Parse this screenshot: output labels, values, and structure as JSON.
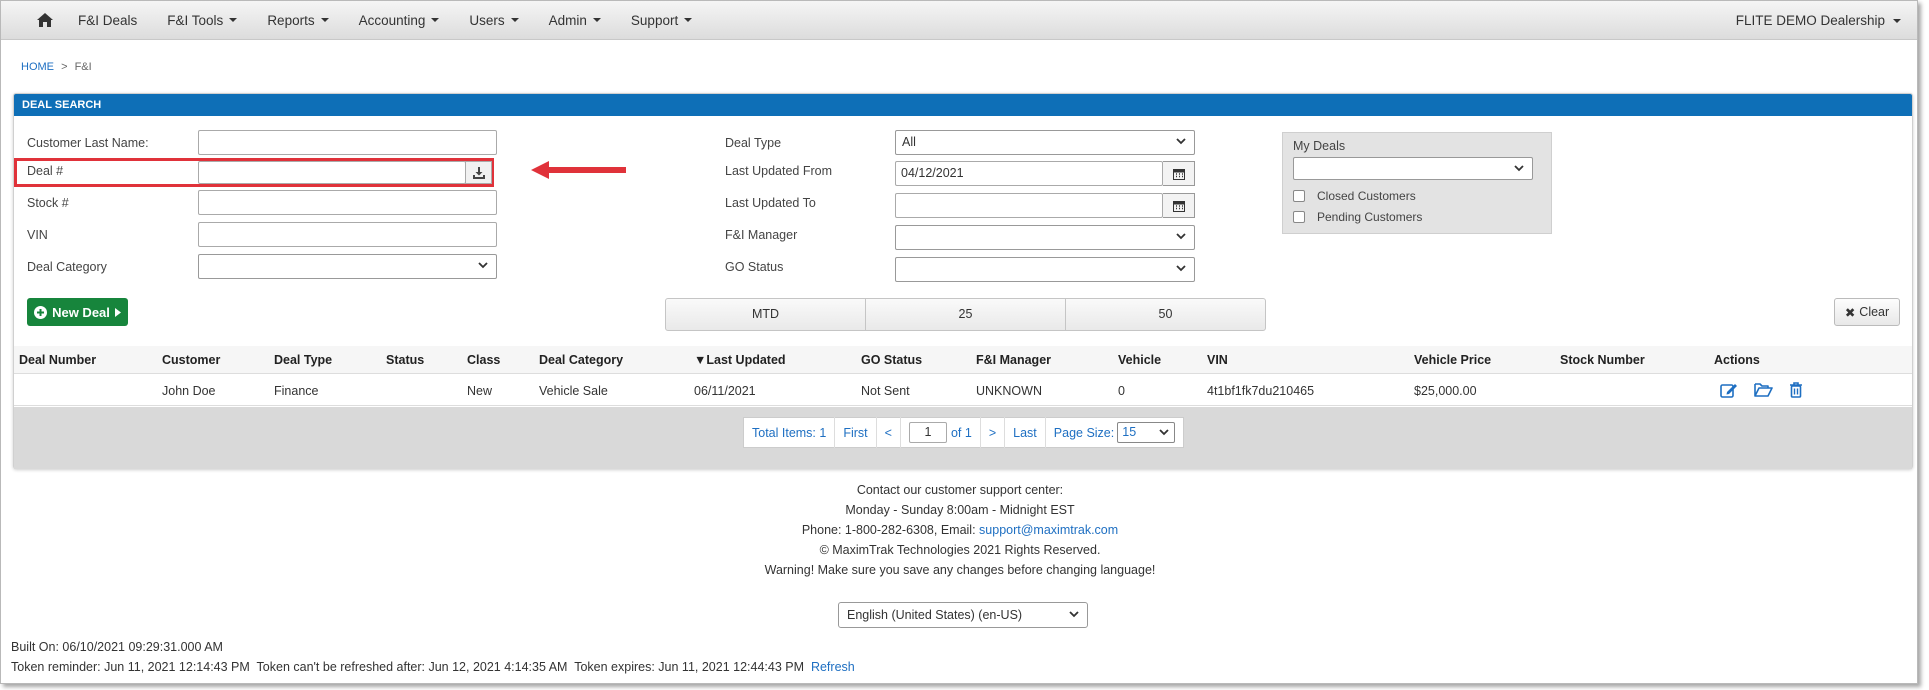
{
  "nav": {
    "items": [
      "F&I Deals",
      "F&I Tools",
      "Reports",
      "Accounting",
      "Users",
      "Admin",
      "Support"
    ],
    "dealership": "FLITE DEMO Dealership"
  },
  "breadcrumb": {
    "home": "HOME",
    "sep": ">",
    "current": "F&I"
  },
  "panel": {
    "title": "DEAL SEARCH"
  },
  "form": {
    "customer_last_name_label": "Customer Last Name:",
    "deal_number_label": "Deal #",
    "stock_label": "Stock #",
    "vin_label": "VIN",
    "deal_category_label": "Deal Category",
    "deal_type_label": "Deal Type",
    "deal_type_value": "All",
    "last_updated_from_label": "Last Updated From",
    "last_updated_from_value": "04/12/2021",
    "last_updated_to_label": "Last Updated To",
    "fi_manager_label": "F&I Manager",
    "go_status_label": "GO Status"
  },
  "my_deals": {
    "title": "My Deals",
    "closed_customers": "Closed Customers",
    "pending_customers": "Pending Customers"
  },
  "buttons": {
    "new_deal": "New Deal",
    "clear": "Clear",
    "segments": [
      "MTD",
      "25",
      "50"
    ]
  },
  "table": {
    "columns": [
      "Deal Number",
      "Customer",
      "Deal Type",
      "Status",
      "Class",
      "Deal Category",
      "Last Updated",
      "GO Status",
      "F&I Manager",
      "Vehicle",
      "VIN",
      "Vehicle Price",
      "Stock Number",
      "Actions"
    ],
    "rows": [
      {
        "deal_number": "",
        "customer": "John Doe",
        "deal_type": "Finance",
        "status": "",
        "class": "New",
        "deal_category": "Vehicle Sale",
        "last_updated": "06/11/2021",
        "go_status": "Not Sent",
        "fi_manager": "UNKNOWN",
        "vehicle": "0",
        "vin": "4t1bf1fk7du210465",
        "vehicle_price": "$25,000.00",
        "stock_number": ""
      }
    ]
  },
  "pager": {
    "total_items": "Total Items: 1",
    "first": "First",
    "prev": "<",
    "page": "1",
    "of": "of 1",
    "next": ">",
    "last": "Last",
    "page_size_label": "Page Size:",
    "page_size": "15"
  },
  "footer": {
    "line1": "Contact our customer support center:",
    "line2": "Monday - Sunday 8:00am - Midnight EST",
    "phone": "Phone: 1-800-282-6308, Email:",
    "email": "support@maximtrak.com",
    "copyright": "© MaximTrak Technologies 2021 Rights Reserved.",
    "warning": "Warning! Make sure you save any changes before changing language!",
    "language": "English (United States) (en-US)"
  },
  "build": {
    "built_on": "Built On: 06/10/2021 09:29:31.000 AM",
    "token_reminder": "Token reminder: Jun 11, 2021 12:14:43 PM",
    "token_refresh": "Token can't be refreshed after: Jun 12, 2021 4:14:35 AM",
    "token_expires": "Token expires: Jun 11, 2021 12:44:43 PM",
    "refresh": "Refresh"
  },
  "colors": {
    "header_blue": "#0e6fb7",
    "green": "#17853c",
    "highlight_red": "#e0323a",
    "link": "#1e6fc2"
  }
}
